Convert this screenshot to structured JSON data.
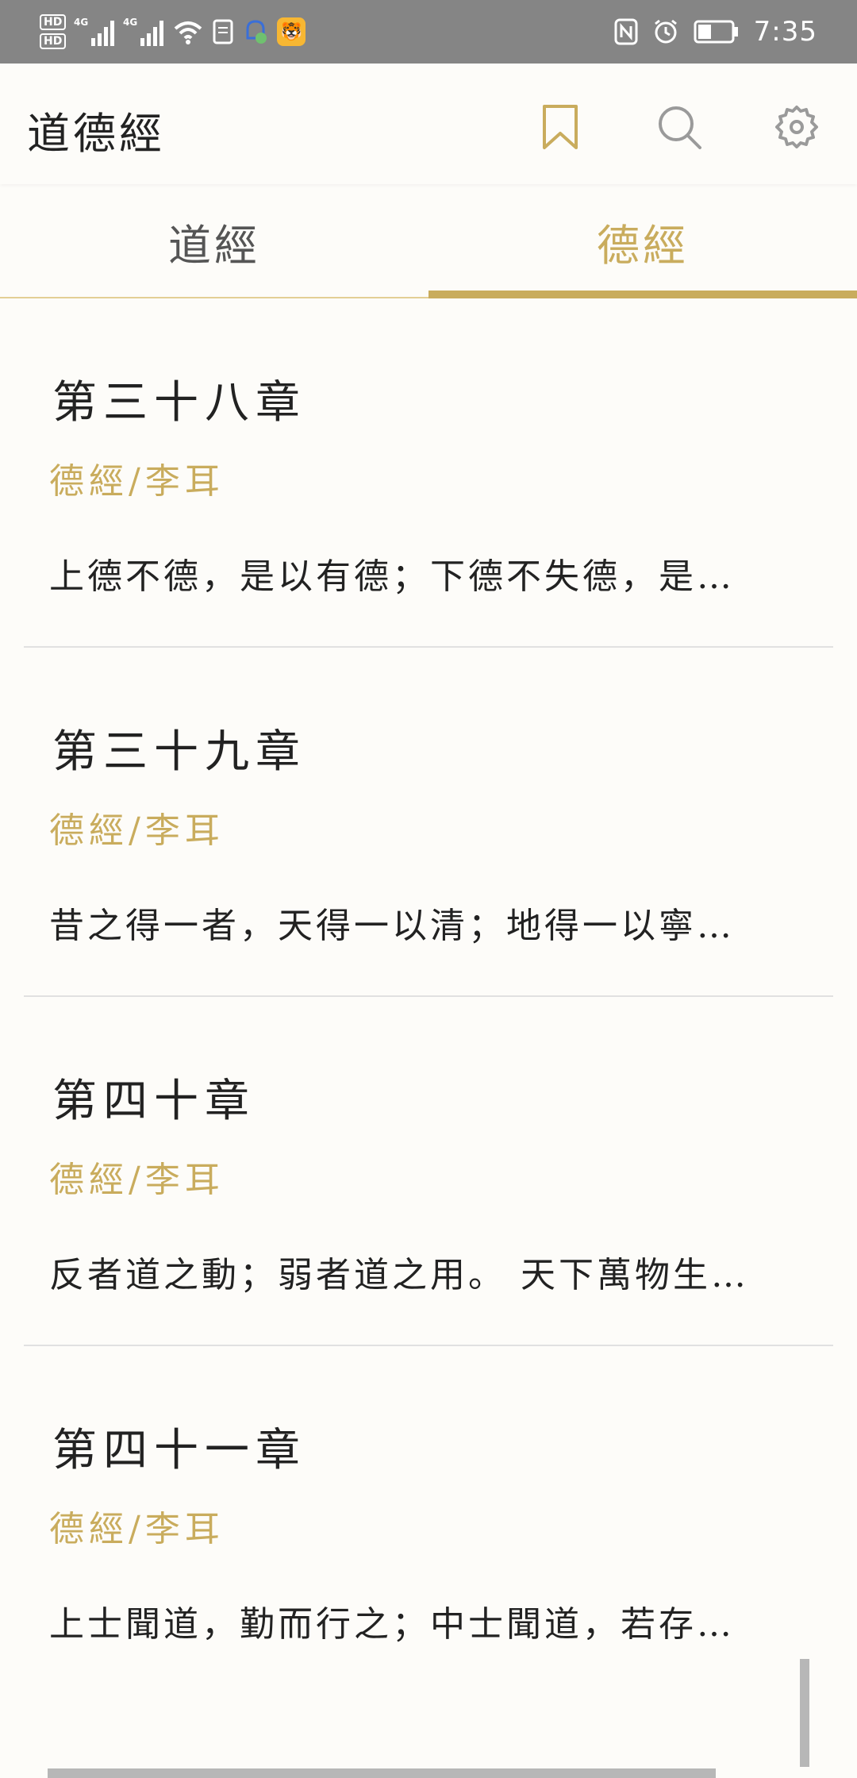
{
  "status_bar": {
    "time": "7:35",
    "sim1": "HD",
    "sim2": "HD",
    "network": "4G",
    "icons": [
      "hd-icon",
      "signal-icon",
      "wifi-icon",
      "notification-icon",
      "nfc-icon",
      "alarm-icon",
      "battery-icon"
    ]
  },
  "app": {
    "title": "道德經",
    "icons": [
      "bookmark-icon",
      "search-icon",
      "gear-icon"
    ],
    "accent_color": "#c9ac5d"
  },
  "tabs": [
    {
      "label": "道經",
      "selected": false
    },
    {
      "label": "德經",
      "selected": true
    }
  ],
  "chapters": [
    {
      "title": "第三十八章",
      "subtitle": "德經/李耳",
      "excerpt": "上德不德，是以有德；下德不失德，是…"
    },
    {
      "title": "第三十九章",
      "subtitle": "德經/李耳",
      "excerpt": "昔之得一者，天得一以清；地得一以寧…"
    },
    {
      "title": "第四十章",
      "subtitle": "德經/李耳",
      "excerpt": "反者道之動；弱者道之用。 天下萬物生…"
    },
    {
      "title": "第四十一章",
      "subtitle": "德經/李耳",
      "excerpt": "上士聞道，勤而行之；中士聞道，若存…"
    }
  ]
}
